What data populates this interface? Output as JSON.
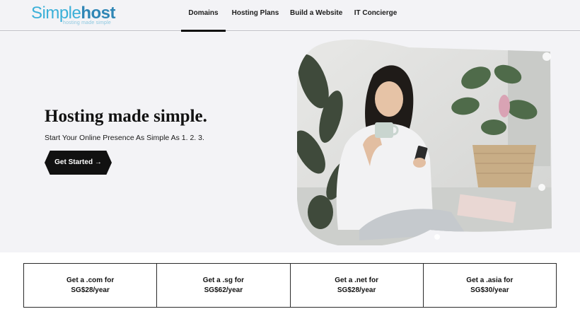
{
  "logo": {
    "part1": "Simple",
    "part2": "host",
    "tagline": "hosting made simple"
  },
  "nav": {
    "items": [
      {
        "label": "Domains",
        "active": true
      },
      {
        "label": "Hosting Plans",
        "active": false
      },
      {
        "label": "Build a Website",
        "active": false
      },
      {
        "label": "IT Concierge",
        "active": false
      }
    ]
  },
  "hero": {
    "title": "Hosting made simple.",
    "subtitle": "Start Your Online Presence As Simple As 1. 2. 3.",
    "cta_label": "Get Started →"
  },
  "pricing": [
    {
      "line1": "Get a .com for",
      "line2": "SG$28/year"
    },
    {
      "line1": "Get a .sg for",
      "line2": "SG$62/year"
    },
    {
      "line1": "Get a .net for",
      "line2": "SG$28/year"
    },
    {
      "line1": "Get a .asia for",
      "line2": "SG$30/year"
    }
  ],
  "colors": {
    "logo_light": "#3bb0d8",
    "logo_dark": "#2f86b5",
    "background": "#f3f3f6",
    "button": "#111111"
  }
}
